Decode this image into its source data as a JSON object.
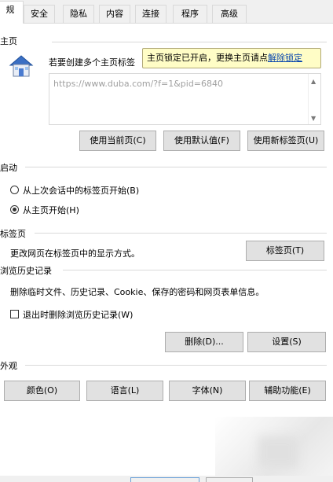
{
  "tabs": [
    "规",
    "安全",
    "隐私",
    "内容",
    "连接",
    "程序",
    "高级"
  ],
  "home": {
    "section_title": "主页",
    "description": "若要创建多个主页标签",
    "url_text": "https://www.duba.com/?f=1&pid=6840",
    "tooltip_text": "主页锁定已开启，更换主页请点",
    "tooltip_link": "解除锁定",
    "buttons": {
      "current": "使用当前页(C)",
      "default": "使用默认值(F)",
      "newtab": "使用新标签页(U)"
    }
  },
  "startup": {
    "section_title": "启动",
    "option_last": "从上次会话中的标签页开始(B)",
    "option_home": "从主页开始(H)"
  },
  "tabs_section": {
    "section_title": "标签页",
    "description": "更改网页在标签页中的显示方式。",
    "button": "标签页(T)"
  },
  "history": {
    "section_title": "浏览历史记录",
    "description": "删除临时文件、历史记录、Cookie、保存的密码和网页表单信息。",
    "checkbox_label": "退出时删除浏览历史记录(W)",
    "delete_button": "删除(D)...",
    "settings_button": "设置(S)"
  },
  "appearance": {
    "section_title": "外观",
    "buttons": [
      "颜色(O)",
      "语言(L)",
      "字体(N)",
      "辅助功能(E)"
    ]
  },
  "colors": {
    "link": "#0645ad",
    "tooltip_bg": "#fffdc6",
    "button_bg": "#e1e1e1"
  }
}
